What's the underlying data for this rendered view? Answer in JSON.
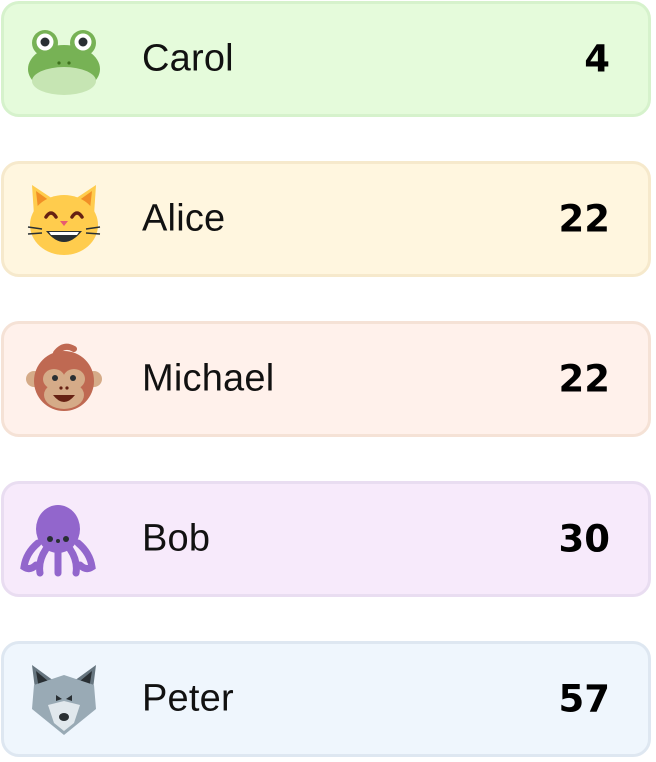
{
  "players": [
    {
      "name": "Carol",
      "score": "4",
      "icon": "frog-icon",
      "bg": "#E5FBDB",
      "border": "#D6F2CC"
    },
    {
      "name": "Alice",
      "score": "22",
      "icon": "cat-icon",
      "bg": "#FFF6DF",
      "border": "#F6E9CC"
    },
    {
      "name": "Michael",
      "score": "22",
      "icon": "monkey-icon",
      "bg": "#FFF1EB",
      "border": "#F5E2D6"
    },
    {
      "name": "Bob",
      "score": "30",
      "icon": "octopus-icon",
      "bg": "#F7EAFB",
      "border": "#E9DDF1"
    },
    {
      "name": "Peter",
      "score": "57",
      "icon": "wolf-icon",
      "bg": "#EFF6FD",
      "border": "#DEE7F1"
    }
  ]
}
